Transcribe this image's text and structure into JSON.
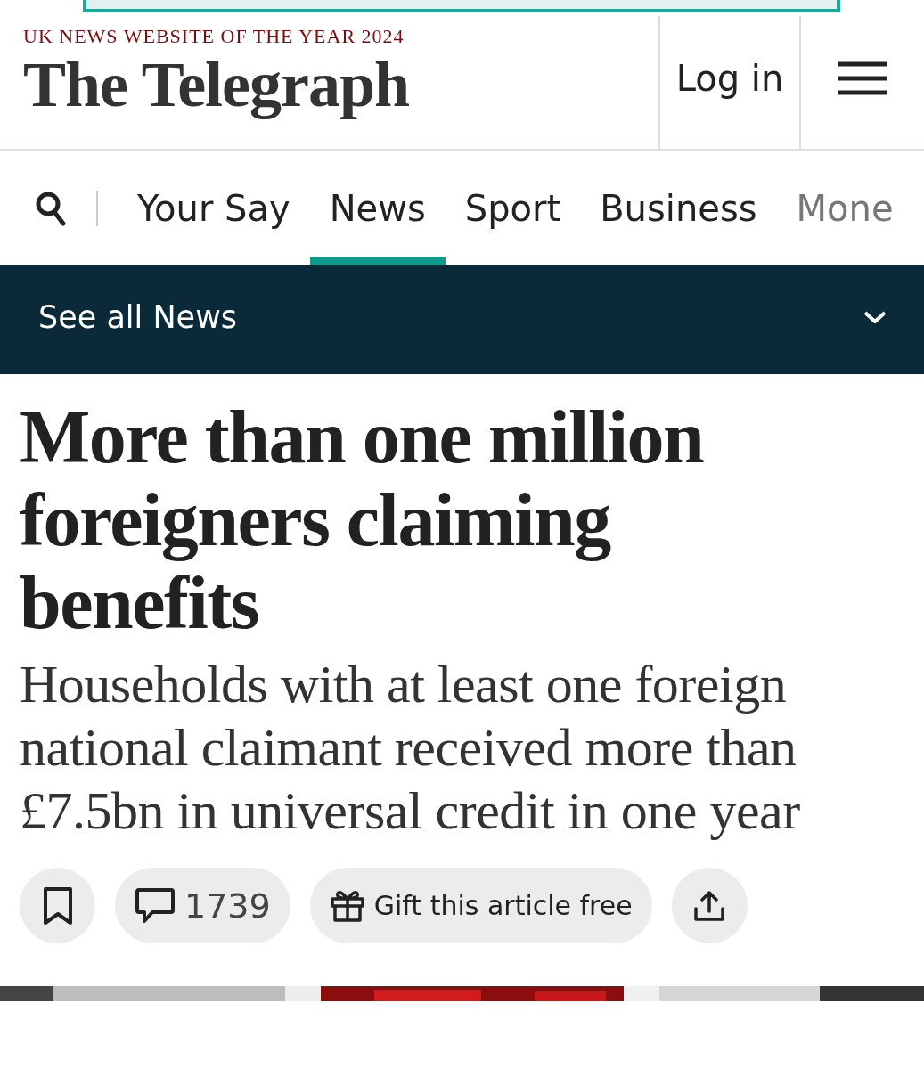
{
  "header": {
    "award": "UK NEWS WEBSITE OF THE YEAR 2024",
    "logo": "The Telegraph",
    "login": "Log in"
  },
  "nav": {
    "tabs": [
      {
        "label": "Your Say",
        "selected": false
      },
      {
        "label": "News",
        "selected": true
      },
      {
        "label": "Sport",
        "selected": false
      },
      {
        "label": "Business",
        "selected": false
      },
      {
        "label": "Mone",
        "selected": false
      }
    ]
  },
  "section_bar": {
    "label": "See all News"
  },
  "article": {
    "headline": "More than one million foreigners claiming benefits",
    "standfirst": "Households with at least one foreign national claimant received more than £7.5bn in universal credit in one year"
  },
  "actions": {
    "comments": "1739",
    "gift": "Gift this article free"
  }
}
